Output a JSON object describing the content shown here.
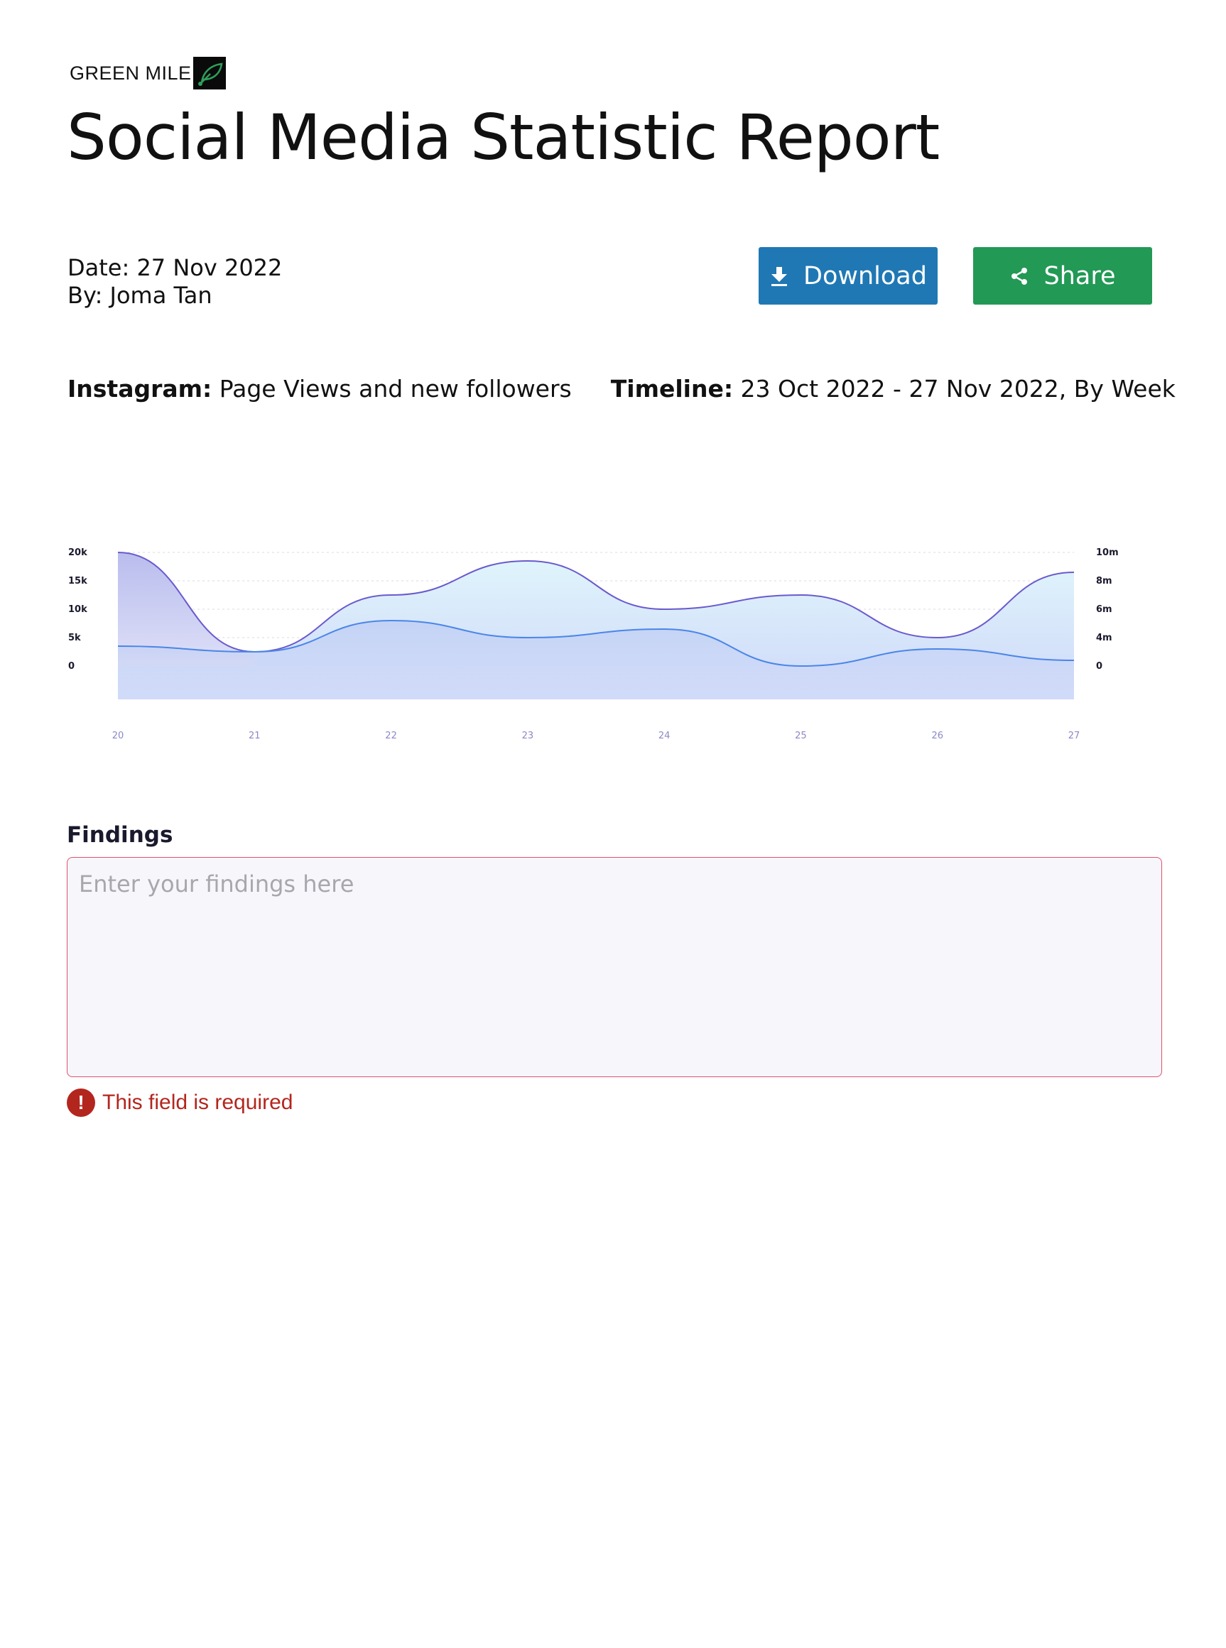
{
  "brand": {
    "name": "GREEN MILE",
    "logo_icon": "leaf-icon"
  },
  "page": {
    "title": "Social Media Statistic Report"
  },
  "meta": {
    "date": "Date: 27 Nov 2022",
    "author": "By: Joma Tan"
  },
  "actions": {
    "download_label": "Download",
    "download_icon": "download-icon",
    "download_color": "#1f78b4",
    "share_label": "Share",
    "share_icon": "share-icon",
    "share_color": "#229955"
  },
  "context": {
    "platform_label": "Instagram:",
    "platform_value": "Page Views and new followers",
    "timeline_label": "Timeline:",
    "timeline_value": "23 Oct 2022 - 27 Nov 2022, By Week"
  },
  "chart_data": {
    "type": "area",
    "x": [
      "20",
      "21",
      "22",
      "23",
      "24",
      "25",
      "26",
      "27"
    ],
    "y_left_ticks": [
      "0",
      "5k",
      "10k",
      "15k",
      "20k"
    ],
    "y_right_ticks": [
      "0",
      "4m",
      "6m",
      "8m",
      "10m"
    ],
    "grid": true,
    "series": [
      {
        "values": [
          20000,
          2500,
          12500,
          18500,
          10000,
          12500,
          5000,
          16500
        ],
        "color": "#6a5acd"
      },
      {
        "values": [
          3500,
          2500,
          8000,
          5000,
          6500,
          0,
          3000,
          1000
        ],
        "color": "#4a86e8"
      }
    ]
  },
  "findings": {
    "label": "Findings",
    "placeholder": "Enter your findings here",
    "error_text": "This field is required",
    "error_color": "#b3261e"
  }
}
